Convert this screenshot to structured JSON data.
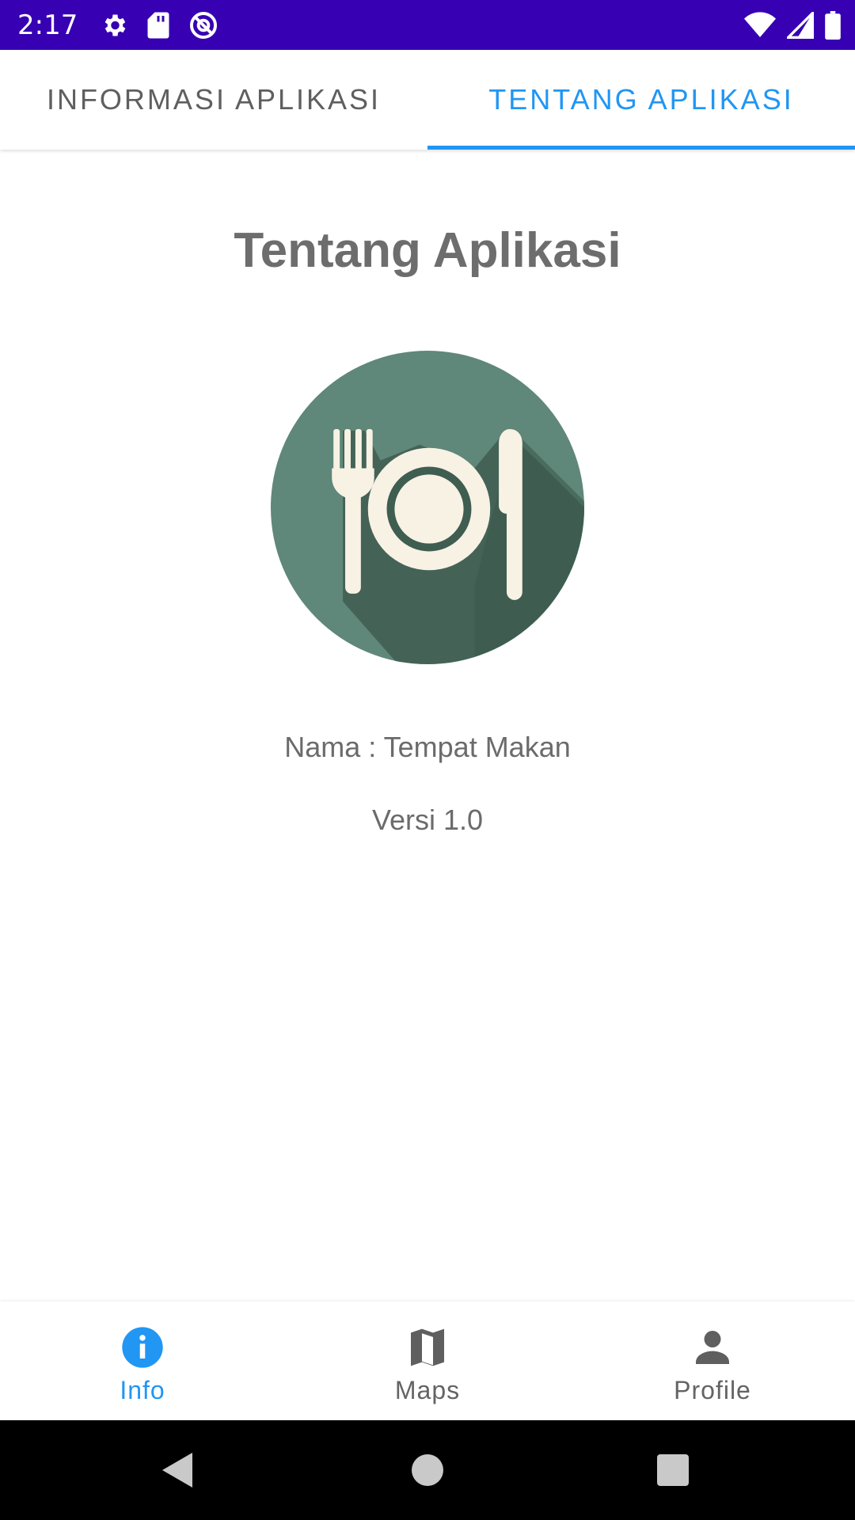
{
  "status_bar": {
    "time": "2:17",
    "left_icons": [
      "gear-icon",
      "sd-card-icon",
      "at-sign-icon"
    ],
    "right_icons": [
      "wifi-icon",
      "signal-icon",
      "battery-icon"
    ],
    "background": "#3700b3"
  },
  "tabs": [
    {
      "label": "INFORMASI APLIKASI",
      "active": false
    },
    {
      "label": "TENTANG APLIKASI",
      "active": true
    }
  ],
  "accent_color": "#2196f3",
  "content": {
    "title": "Tentang Aplikasi",
    "logo_icon": "plate-fork-knife-icon",
    "name_line": "Nama : Tempat Makan",
    "version_line": "Versi 1.0"
  },
  "bottom_nav": [
    {
      "label": "Info",
      "icon": "info-icon",
      "active": true
    },
    {
      "label": "Maps",
      "icon": "map-icon",
      "active": false
    },
    {
      "label": "Profile",
      "icon": "person-icon",
      "active": false
    }
  ],
  "system_nav": [
    "back-icon",
    "home-icon",
    "recents-icon"
  ]
}
